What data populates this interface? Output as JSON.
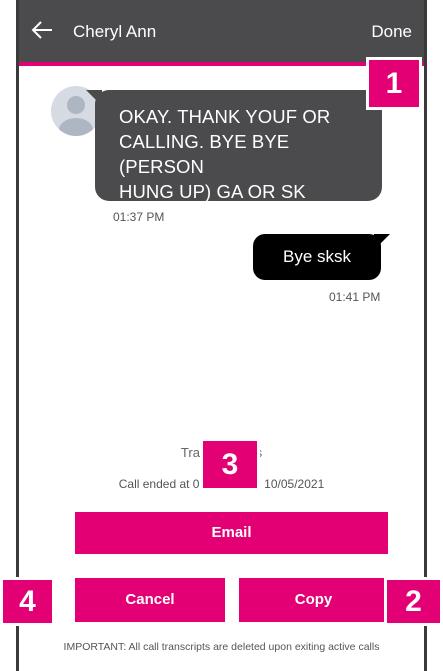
{
  "header": {
    "contact_name": "Cheryl Ann",
    "done_label": "Done"
  },
  "messages": [
    {
      "direction": "incoming",
      "lines": [
        "OKAY.  THANK YOUF OR",
        "CALLING. BYE BYE (PERSON",
        "HUNG UP) GA OR SK"
      ],
      "time": "01:37 PM"
    },
    {
      "direction": "outgoing",
      "text": "Bye sksk",
      "time": "01:41 PM"
    }
  ],
  "footer": {
    "title": "Transcriptions",
    "call_ended": "Call ended at 01:41 PM on 10/05/2021",
    "email_label": "Email",
    "cancel_label": "Cancel",
    "copy_label": "Copy",
    "important_note": "IMPORTANT: All call transcripts are deleted upon exiting active calls"
  },
  "callouts": [
    "1",
    "2",
    "3",
    "4"
  ],
  "icons": {
    "back": "back-arrow-icon",
    "avatar": "person-avatar-icon"
  },
  "colors": {
    "accent": "#e20074",
    "header_bg": "#4b4b4d",
    "incoming_bubble": "#4b4b4d",
    "outgoing_bubble": "#000000"
  }
}
